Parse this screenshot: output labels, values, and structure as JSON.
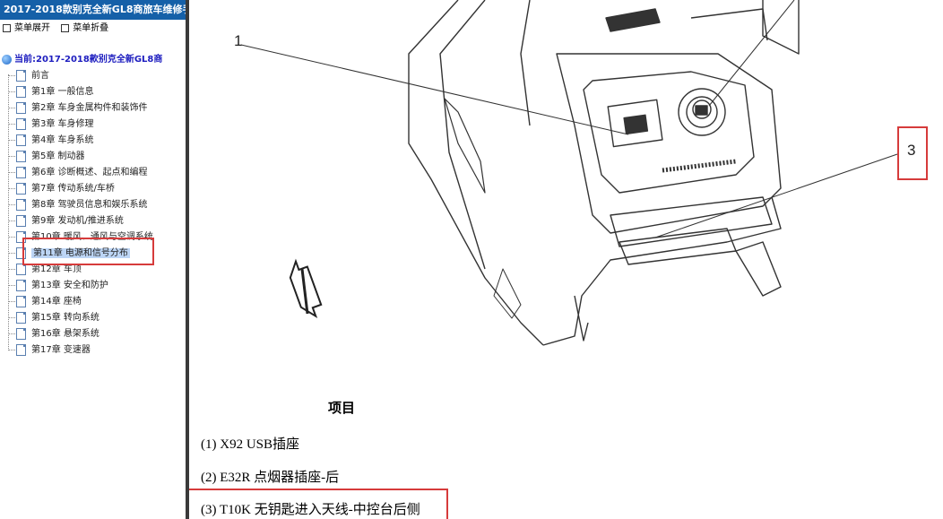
{
  "app": {
    "title": "2017-2018款别克全新GL8商旅车维修手"
  },
  "menubar": {
    "expand_label": "菜单展开",
    "collapse_label": "菜单折叠"
  },
  "tree": {
    "current_label": "当前:2017-2018款别克全新GL8商",
    "items": [
      {
        "label": "前言"
      },
      {
        "label": "第1章 一般信息"
      },
      {
        "label": "第2章 车身金属构件和装饰件"
      },
      {
        "label": "第3章 车身修理"
      },
      {
        "label": "第4章 车身系统"
      },
      {
        "label": "第5章 制动器"
      },
      {
        "label": "第6章 诊断概述、起点和编程"
      },
      {
        "label": "第7章 传动系统/车桥"
      },
      {
        "label": "第8章 驾驶员信息和娱乐系统"
      },
      {
        "label": "第9章 发动机/推进系统"
      },
      {
        "label": "第10章 暖风、通风与空调系统"
      },
      {
        "label": "第11章 电源和信号分布",
        "selected": true
      },
      {
        "label": "第12章 车顶"
      },
      {
        "label": "第13章 安全和防护"
      },
      {
        "label": "第14章 座椅"
      },
      {
        "label": "第15章 转向系统"
      },
      {
        "label": "第16章 悬架系统"
      },
      {
        "label": "第17章 变速器"
      }
    ]
  },
  "content": {
    "callouts": {
      "c1": "1",
      "c3": "3"
    },
    "legend_title": "项目",
    "legend_items": [
      {
        "text": "(1) X92 USB插座"
      },
      {
        "text": "(2) E32R 点烟器插座-后"
      },
      {
        "text": "(3) T10K 无钥匙进入天线-中控台后侧"
      }
    ]
  },
  "colors": {
    "title_bg": "#1560a8",
    "highlight_box": "#d63b3b",
    "current_text": "#1d1dbf",
    "selected_bg": "#bcd5f5"
  },
  "icons": {
    "tree_node": "document-icon",
    "current": "globe-icon",
    "menu": "square-icon"
  }
}
